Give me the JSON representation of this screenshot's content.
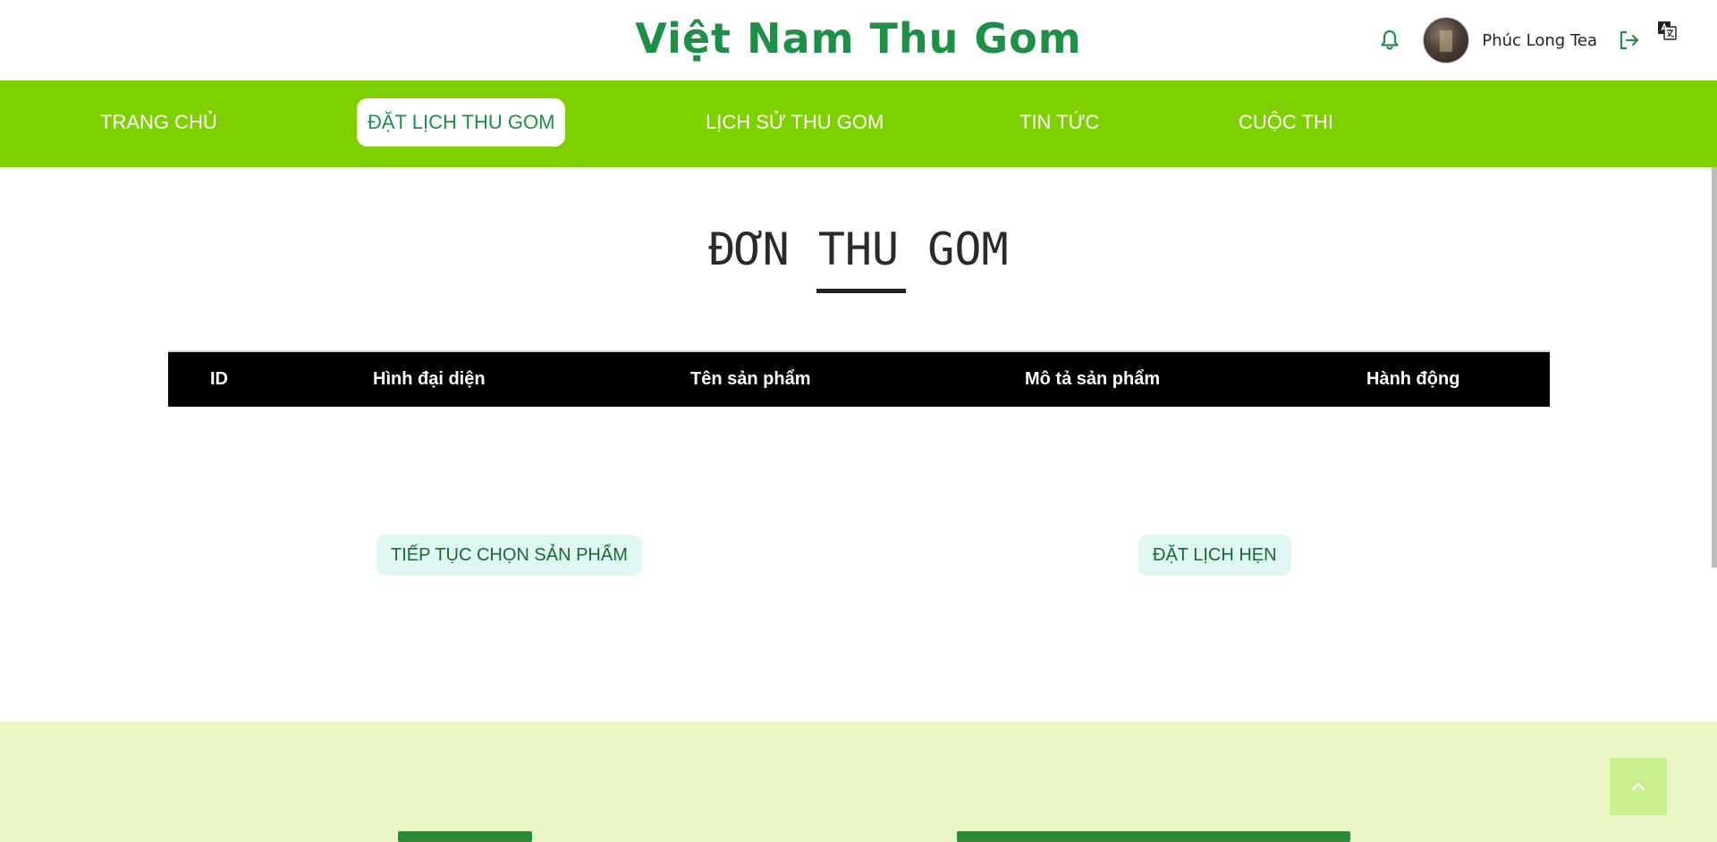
{
  "header": {
    "brand": "Việt Nam Thu Gom",
    "username": "Phúc Long Tea",
    "icons": {
      "notification": "bell-icon",
      "logout": "logout-icon",
      "translate": "translate-icon"
    },
    "brand_color": "#1e8f46"
  },
  "nav": {
    "background": "#7fd000",
    "items": [
      {
        "label": "TRANG CHỦ",
        "active": false
      },
      {
        "label": "ĐẶT LỊCH THU GOM",
        "active": true
      },
      {
        "label": "LỊCH SỬ THU GOM",
        "active": false
      },
      {
        "label": "TIN TỨC",
        "active": false
      },
      {
        "label": "CUỘC THI",
        "active": false
      }
    ]
  },
  "main": {
    "title": "ĐƠN THU GOM",
    "table": {
      "columns": [
        "ID",
        "Hình đại diện",
        "Tên sản phẩm",
        "Mô tả sản phẩm",
        "Hành động"
      ],
      "rows": []
    },
    "buttons": {
      "continue": "TIẾP TỤC CHỌN SẢN PHẨM",
      "book": "ĐẶT LỊCH HẸN"
    }
  },
  "footer": {
    "background": "#eaf5c6",
    "back_to_top_icon": "chevron-up-icon"
  }
}
